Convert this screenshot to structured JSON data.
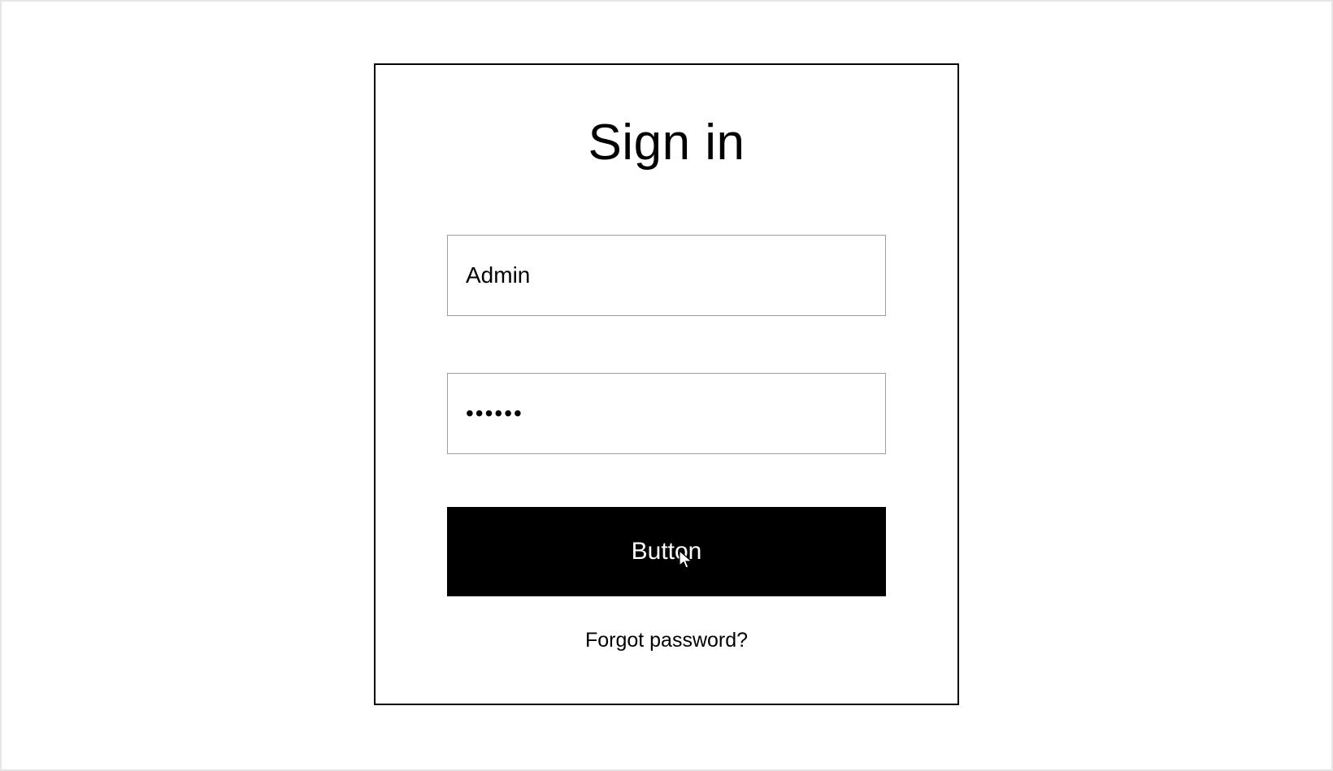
{
  "form": {
    "heading": "Sign in",
    "username_value": "Admin",
    "password_value": "••••••",
    "submit_label": "Button",
    "forgot_label": "Forgot password?"
  }
}
